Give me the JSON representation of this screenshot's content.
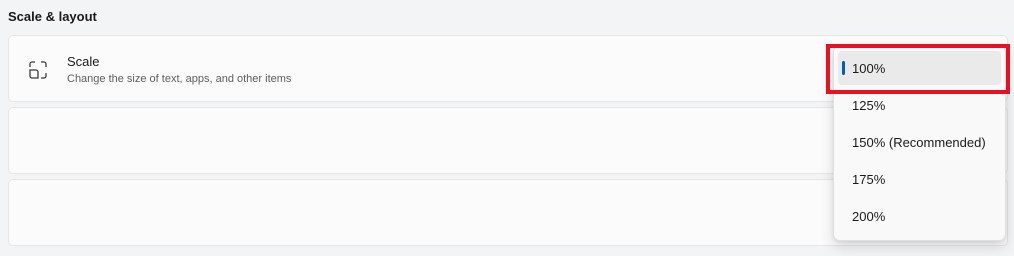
{
  "section": {
    "title": "Scale & layout"
  },
  "scale_setting": {
    "label": "Scale",
    "description": "Change the size of text, apps, and other items",
    "icon": "scale-frame-icon"
  },
  "dropdown": {
    "selected": "100%",
    "options": [
      {
        "label": "100%",
        "selected": true
      },
      {
        "label": "125%",
        "selected": false
      },
      {
        "label": "150% (Recommended)",
        "selected": false
      },
      {
        "label": "175%",
        "selected": false
      },
      {
        "label": "200%",
        "selected": false
      }
    ]
  },
  "colors": {
    "accent": "#005fb8",
    "highlight": "#e81123"
  }
}
